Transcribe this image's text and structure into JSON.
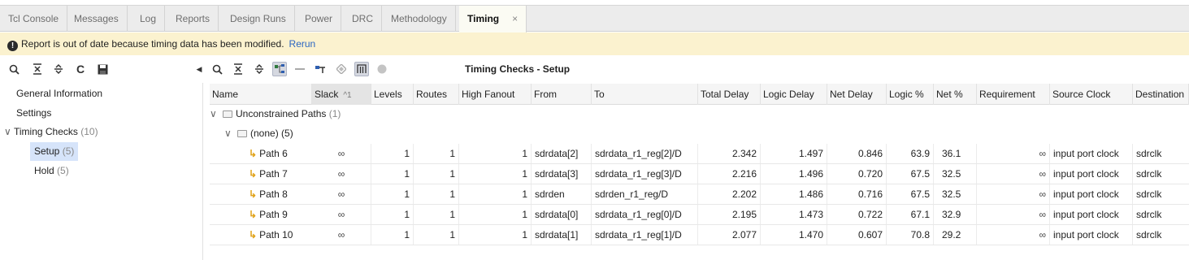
{
  "tabs": [
    {
      "label": "Tcl Console"
    },
    {
      "label": "Messages"
    },
    {
      "label": "Log"
    },
    {
      "label": "Reports"
    },
    {
      "label": "Design Runs"
    },
    {
      "label": "Power"
    },
    {
      "label": "DRC"
    },
    {
      "label": "Methodology"
    },
    {
      "label": "Timing",
      "close": "×"
    }
  ],
  "warning": {
    "icon": "info-icon",
    "text": "Report is out of date because timing data has been modified.",
    "link": "Rerun"
  },
  "toolbar_left": [
    "search-icon",
    "collapse-all-icon",
    "expand-all-icon",
    "refresh-icon",
    "save-icon"
  ],
  "toolbar_right": [
    "search-icon",
    "collapse-all-icon",
    "expand-all-icon",
    "hierarchy-icon",
    "minus-icon",
    "schematic-icon",
    "diamond-icon",
    "columns-icon",
    "circle-icon"
  ],
  "view_title": "Timing Checks - Setup",
  "tree": {
    "general": "General Information",
    "settings": "Settings",
    "timing_checks": {
      "label": "Timing Checks",
      "count": "(10)"
    },
    "setup": {
      "label": "Setup",
      "count": "(5)"
    },
    "hold": {
      "label": "Hold",
      "count": "(5)"
    }
  },
  "columns": [
    "Name",
    "Slack",
    "Levels",
    "Routes",
    "High Fanout",
    "From",
    "To",
    "Total Delay",
    "Logic Delay",
    "Net Delay",
    "Logic %",
    "Net %",
    "Requirement",
    "Source Clock",
    "Destination"
  ],
  "sort_indicator": "^1",
  "groups": {
    "unconstrained": {
      "label": "Unconstrained Paths",
      "count": "(1)"
    },
    "none": {
      "label": "(none)",
      "count": "(5)"
    }
  },
  "rows": [
    {
      "name": "Path 6",
      "slack": "∞",
      "levels": "1",
      "routes": "1",
      "fanout": "1",
      "from": "sdrdata[2]",
      "to": "sdrdata_r1_reg[2]/D",
      "total": "2.342",
      "logic": "1.497",
      "net": "0.846",
      "logicp": "63.9",
      "netp": "36.1",
      "req": "∞",
      "src": "input port clock",
      "dst": "sdrclk"
    },
    {
      "name": "Path 7",
      "slack": "∞",
      "levels": "1",
      "routes": "1",
      "fanout": "1",
      "from": "sdrdata[3]",
      "to": "sdrdata_r1_reg[3]/D",
      "total": "2.216",
      "logic": "1.496",
      "net": "0.720",
      "logicp": "67.5",
      "netp": "32.5",
      "req": "∞",
      "src": "input port clock",
      "dst": "sdrclk"
    },
    {
      "name": "Path 8",
      "slack": "∞",
      "levels": "1",
      "routes": "1",
      "fanout": "1",
      "from": "sdrden",
      "to": "sdrden_r1_reg/D",
      "total": "2.202",
      "logic": "1.486",
      "net": "0.716",
      "logicp": "67.5",
      "netp": "32.5",
      "req": "∞",
      "src": "input port clock",
      "dst": "sdrclk"
    },
    {
      "name": "Path 9",
      "slack": "∞",
      "levels": "1",
      "routes": "1",
      "fanout": "1",
      "from": "sdrdata[0]",
      "to": "sdrdata_r1_reg[0]/D",
      "total": "2.195",
      "logic": "1.473",
      "net": "0.722",
      "logicp": "67.1",
      "netp": "32.9",
      "req": "∞",
      "src": "input port clock",
      "dst": "sdrclk"
    },
    {
      "name": "Path 10",
      "slack": "∞",
      "levels": "1",
      "routes": "1",
      "fanout": "1",
      "from": "sdrdata[1]",
      "to": "sdrdata_r1_reg[1]/D",
      "total": "2.077",
      "logic": "1.470",
      "net": "0.607",
      "logicp": "70.8",
      "netp": "29.2",
      "req": "∞",
      "src": "input port clock",
      "dst": "sdrclk"
    }
  ]
}
